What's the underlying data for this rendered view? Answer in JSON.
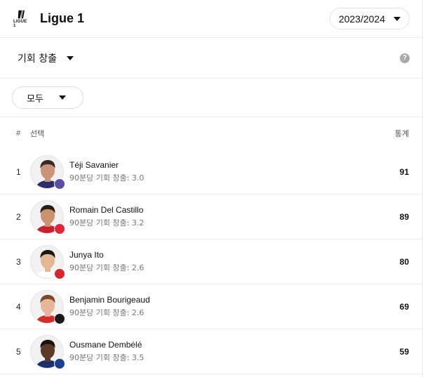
{
  "header": {
    "logo_text": "LIGUE 1",
    "league_title": "Ligue 1",
    "season": "2023/2024"
  },
  "stat_selector": {
    "label": "기회 창출",
    "help_symbol": "?"
  },
  "filter": {
    "label": "모두"
  },
  "columns": {
    "rank": "#",
    "player": "선택",
    "stat": "통계"
  },
  "players": [
    {
      "rank": "1",
      "name": "Téji Savanier",
      "sub": "90분당 기회 창출: 3.0",
      "value": "91",
      "badge_color": "#5a4fa8",
      "skin": "#c99477",
      "hair": "#3a2a22",
      "shirt": "#2d2d6b"
    },
    {
      "rank": "2",
      "name": "Romain Del Castillo",
      "sub": "90분당 기회 창출: 3.2",
      "value": "89",
      "badge_color": "#e0263a",
      "skin": "#c9936f",
      "hair": "#2b1d16",
      "shirt": "#c9202f"
    },
    {
      "rank": "3",
      "name": "Junya Ito",
      "sub": "90분당 기회 창출: 2.6",
      "value": "80",
      "badge_color": "#d7262e",
      "skin": "#e2b795",
      "hair": "#1d1712",
      "shirt": "#ffffff"
    },
    {
      "rank": "4",
      "name": "Benjamin Bourigeaud",
      "sub": "90분당 기회 창출: 2.6",
      "value": "69",
      "badge_color": "#1a1a1a",
      "skin": "#e6b59a",
      "hair": "#7a4a2a",
      "shirt": "#d42b2b"
    },
    {
      "rank": "5",
      "name": "Ousmane Dembélé",
      "sub": "90분당 기회 창출: 3.5",
      "value": "59",
      "badge_color": "#1d3e8c",
      "skin": "#5b3a28",
      "hair": "#1a120d",
      "shirt": "#1b2f6e"
    }
  ]
}
